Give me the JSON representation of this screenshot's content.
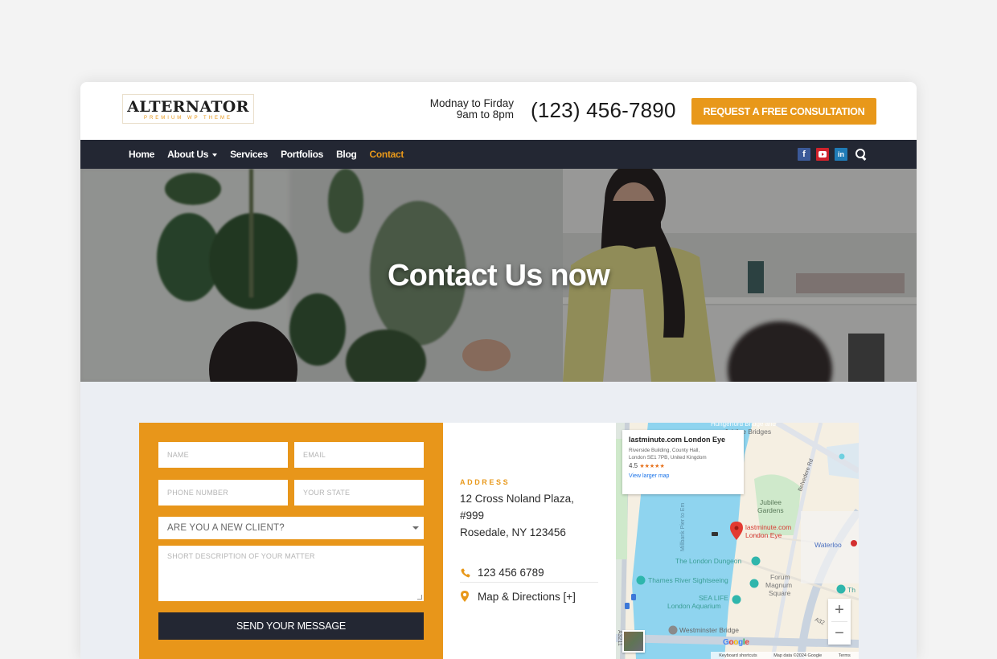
{
  "header": {
    "logo_title": "ALTERNATOR",
    "logo_subtitle": "PREMIUM WP THEME",
    "hours_line1": "Modnay to Firday",
    "hours_line2": "9am to 8pm",
    "phone": "(123) 456-7890",
    "cta_label": "REQUEST A FREE CONSULTATION"
  },
  "nav": {
    "items": [
      {
        "label": "Home",
        "active": false
      },
      {
        "label": "About Us",
        "active": false,
        "has_dropdown": true
      },
      {
        "label": "Services",
        "active": false
      },
      {
        "label": "Portfolios",
        "active": false
      },
      {
        "label": "Blog",
        "active": false
      },
      {
        "label": "Contact",
        "active": true
      }
    ],
    "socials": [
      {
        "name": "facebook-icon",
        "glyph": "f"
      },
      {
        "name": "youtube-icon",
        "glyph": "▶"
      },
      {
        "name": "linkedin-icon",
        "glyph": "in"
      }
    ],
    "search_icon": "search-icon"
  },
  "hero": {
    "title": "Contact Us now"
  },
  "form": {
    "name_placeholder": "NAME",
    "email_placeholder": "EMAIL",
    "phone_placeholder": "PHONE NUMBER",
    "state_placeholder": "YOUR STATE",
    "client_select_value": "ARE YOU A NEW CLIENT?",
    "description_placeholder": "SHORT DESCRIPTION OF YOUR MATTER",
    "submit_label": "SEND YOUR MESSAGE"
  },
  "contact_info": {
    "address_label": "ADDRESS",
    "address_line1": "12 Cross Noland Plaza,",
    "address_line2": "#999",
    "address_line3": "Rosedale, NY 123456",
    "phone": "123 456 6789",
    "map_link": "Map & Directions [+]"
  },
  "map": {
    "card_title": "lastminute.com London Eye",
    "card_address_line1": "Riverside Building, County Hall,",
    "card_address_line2": "London SE1 7PB, United Kingdom",
    "rating": "4.5",
    "stars": "★★★★★",
    "view_larger": "View larger map",
    "labels": {
      "bridges_top": "Hungerford Bridge and",
      "bridges": "Jubilee Bridges",
      "jubilee1": "Jubilee",
      "jubilee2": "Gardens",
      "pin1": "lastminute.com",
      "pin2": "London Eye",
      "waterloo": "Waterloo",
      "dungeon": "The London Dungeon",
      "thames": "Thames River Sightseeing",
      "forum1": "Forum",
      "forum2": "Magnum",
      "forum3": "Square",
      "sealife1": "SEA LIFE",
      "sealife2": "London Aquarium",
      "westminster": "Westminster Bridge",
      "belvedere": "Belvedere Rd",
      "millbank": "Millbank Pier to Em",
      "a3211": "A3211",
      "a32": "A32",
      "th": "Th"
    },
    "zoom_in": "+",
    "zoom_out": "−",
    "google": "Google",
    "footer_shortcuts": "Keyboard shortcuts",
    "footer_data": "Map data ©2024 Google",
    "footer_terms": "Terms"
  }
}
